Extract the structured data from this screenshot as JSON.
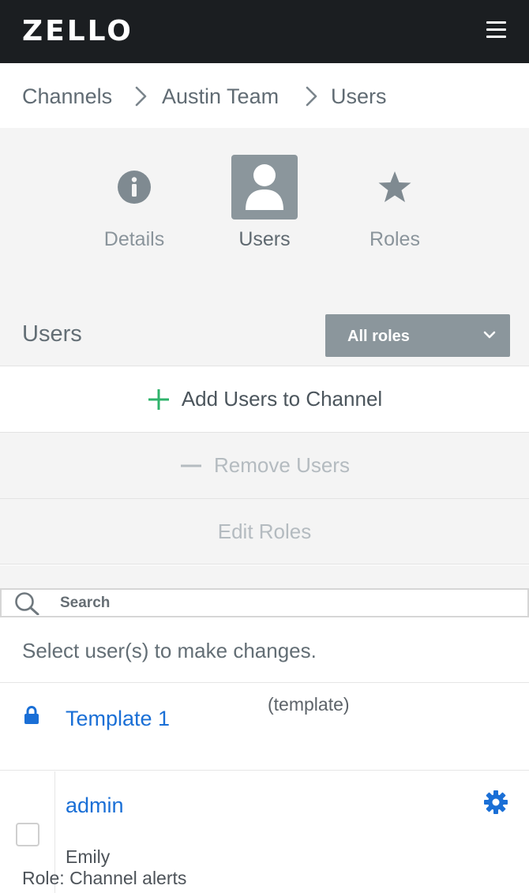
{
  "header": {
    "logo_text": "ZELLO",
    "menu_icon": "hamburger-menu-icon"
  },
  "breadcrumb": {
    "items": [
      "Channels",
      "Austin Team",
      "Users"
    ],
    "separator_icon": "chevron-right-icon"
  },
  "tabs": [
    {
      "label": "Details",
      "icon": "info-icon",
      "active": false
    },
    {
      "label": "Users",
      "icon": "user-icon",
      "active": true
    },
    {
      "label": "Roles",
      "icon": "star-icon",
      "active": false
    }
  ],
  "users_section": {
    "heading": "Users",
    "role_filter": {
      "selected": "All roles",
      "icon": "chevron-down-icon"
    }
  },
  "actions": {
    "add_label": "Add Users to Channel",
    "add_icon": "plus-icon",
    "remove_label": "Remove Users",
    "remove_icon": "minus-icon",
    "edit_label": "Edit Roles"
  },
  "search": {
    "placeholder": "Search",
    "value": "",
    "icon": "search-icon"
  },
  "hint": "Select user(s) to make changes.",
  "template_row": {
    "name": "Template 1",
    "tag": "(template)",
    "icon": "lock-icon"
  },
  "users": [
    {
      "username": "admin",
      "display_name": "Emily",
      "role_text": "Role: Channel alerts",
      "icon": "gear-icon"
    }
  ],
  "colors": {
    "topbar": "#1b1e21",
    "link_blue": "#1a6fd6",
    "add_green": "#2fb36b",
    "tab_active_bg": "#8b969c",
    "panel_gray": "#f4f4f4"
  }
}
